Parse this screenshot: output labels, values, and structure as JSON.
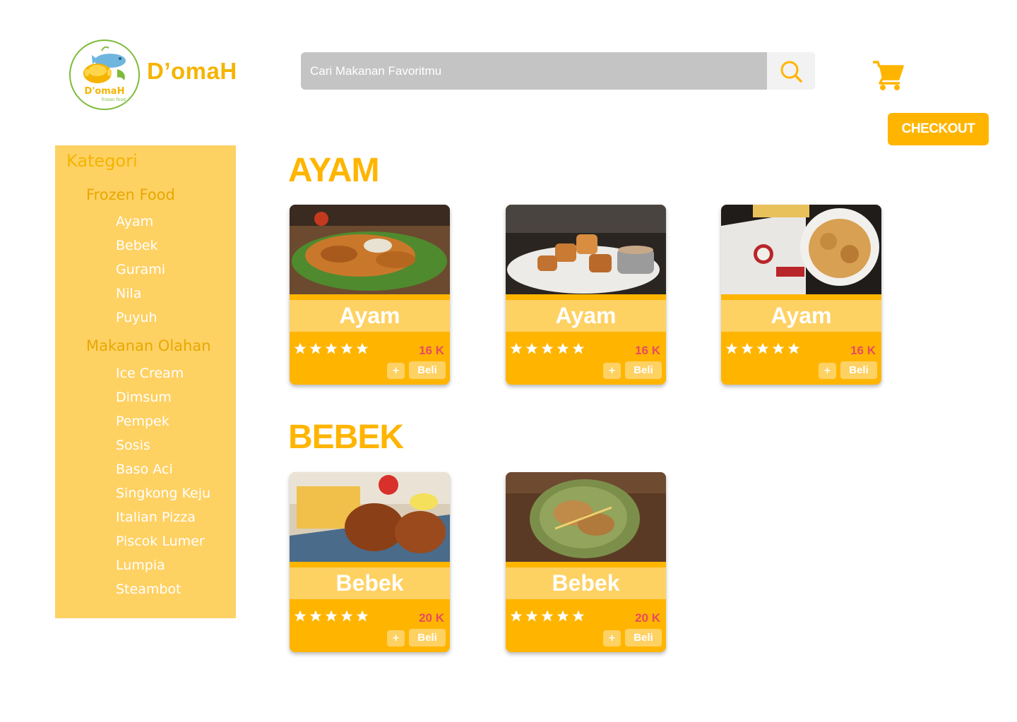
{
  "brand": {
    "logo_text": "D'omaH",
    "logo_subtext": "frozen food",
    "name": "D’omaH"
  },
  "search": {
    "placeholder": "Cari Makanan Favoritmu",
    "icon": "search-icon"
  },
  "cart": {
    "icon": "cart-icon"
  },
  "checkout": {
    "label": "CHECKOUT"
  },
  "colors": {
    "accent": "#ffb500",
    "accent_light": "#fed163",
    "price": "#e84a5f",
    "search_bg": "#c4c4c4"
  },
  "sidebar": {
    "title": "Kategori",
    "groups": [
      {
        "title": "Frozen Food",
        "items": [
          "Ayam",
          "Bebek",
          "Gurami",
          "Nila",
          "Puyuh"
        ]
      },
      {
        "title": "Makanan Olahan",
        "items": [
          "Ice Cream",
          "Dimsum",
          "Pempek",
          "Sosis",
          "Baso Aci",
          "Singkong Keju",
          "Italian Pizza",
          "Piscok Lumer",
          "Lumpia",
          "Steambot"
        ]
      }
    ]
  },
  "sections": [
    {
      "title": "AYAM",
      "products": [
        {
          "name": "Ayam",
          "price": "16 K",
          "rating": 5,
          "plus_label": "+",
          "buy_label": "Beli"
        },
        {
          "name": "Ayam",
          "price": "16 K",
          "rating": 5,
          "plus_label": "+",
          "buy_label": "Beli"
        },
        {
          "name": "Ayam",
          "price": "16 K",
          "rating": 5,
          "plus_label": "+",
          "buy_label": "Beli"
        }
      ]
    },
    {
      "title": "BEBEK",
      "products": [
        {
          "name": "Bebek",
          "price": "20 K",
          "rating": 5,
          "plus_label": "+",
          "buy_label": "Beli"
        },
        {
          "name": "Bebek",
          "price": "20 K",
          "rating": 5,
          "plus_label": "+",
          "buy_label": "Beli"
        }
      ]
    }
  ]
}
